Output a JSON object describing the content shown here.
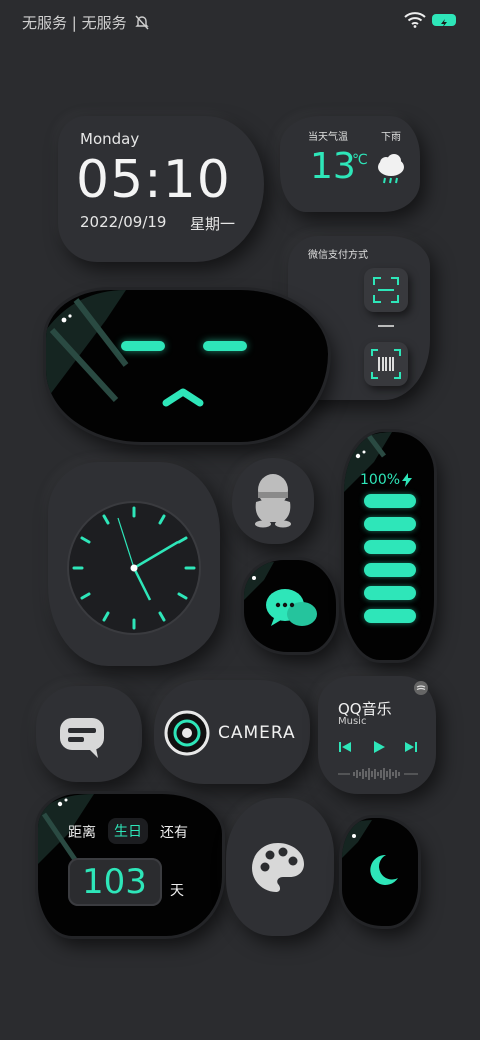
{
  "status_bar": {
    "carrier_text": "无服务 | 无服务",
    "icons": [
      "bell-off-icon",
      "wifi-icon",
      "battery-icon"
    ],
    "battery_color": "#2ee6b9"
  },
  "clock_widget": {
    "day": "Monday",
    "time": "05:10",
    "date": "2022/09/19",
    "weekday": "星期一"
  },
  "weather_widget": {
    "label": "当天气温",
    "condition": "下雨",
    "temperature": "13",
    "unit": "℃",
    "icon": "rain-cloud-icon"
  },
  "wechat_pay_widget": {
    "title": "微信支付方式",
    "icons": [
      "scan-icon",
      "barcode-icon"
    ]
  },
  "battery_widget": {
    "percent": "100%",
    "level": 1.0,
    "bars": 6,
    "icon": "bolt-icon"
  },
  "qq_music_widget": {
    "title": "QQ音乐",
    "subtitle": "Music",
    "controls": [
      "previous-icon",
      "play-icon",
      "next-icon"
    ]
  },
  "camera_widget": {
    "label": "CAMERA"
  },
  "birthday_widget": {
    "prefix": "距离",
    "event": "生日",
    "suffix": "还有",
    "days": "103",
    "unit": "天"
  },
  "apps": [
    "qq-icon",
    "wechat-icon",
    "message-icon",
    "palette-icon",
    "moon-icon"
  ],
  "accent_color": "#2ee6b9",
  "background_color": "#2b2c2f"
}
